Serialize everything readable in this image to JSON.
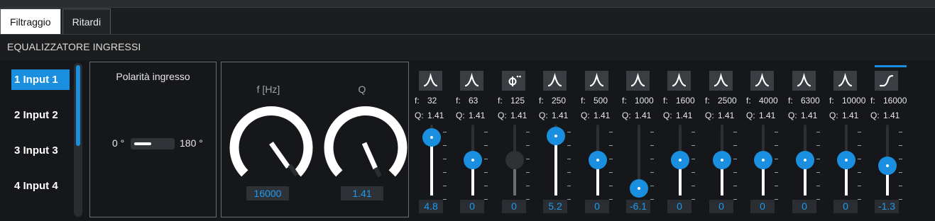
{
  "tabs": [
    {
      "label": "Filtraggio",
      "active": true
    },
    {
      "label": "Ritardi",
      "active": false
    }
  ],
  "section_title": "EQUALIZZATORE INGRESSI",
  "inputs": [
    {
      "label": "1  Input 1",
      "selected": true
    },
    {
      "label": "2  Input 2",
      "selected": false
    },
    {
      "label": "3  Input 3",
      "selected": false
    },
    {
      "label": "4  Input 4",
      "selected": false
    }
  ],
  "polarity": {
    "title": "Polarità ingresso",
    "left_label": "0 °",
    "right_label": "180 °",
    "state": "0 °"
  },
  "knobs": {
    "freq": {
      "label": "f [Hz]",
      "value": "16000"
    },
    "q": {
      "label": "Q",
      "value": "1.41"
    }
  },
  "bands": [
    {
      "type": "peak-icon",
      "f": "32",
      "q": "1.41",
      "gain": "4.8",
      "level": 0.82,
      "enabled": true,
      "selected": false
    },
    {
      "type": "peak-icon",
      "f": "63",
      "q": "1.41",
      "gain": "0",
      "level": 0.5,
      "enabled": true,
      "selected": false
    },
    {
      "type": "phase-icon",
      "f": "125",
      "q": "1.41",
      "gain": "0",
      "level": 0.5,
      "enabled": false,
      "selected": false
    },
    {
      "type": "peak-icon",
      "f": "250",
      "q": "1.41",
      "gain": "5.2",
      "level": 0.84,
      "enabled": true,
      "selected": false
    },
    {
      "type": "peak-icon",
      "f": "500",
      "q": "1.41",
      "gain": "0",
      "level": 0.5,
      "enabled": true,
      "selected": false
    },
    {
      "type": "peak-icon",
      "f": "1000",
      "q": "1.41",
      "gain": "-6.1",
      "level": 0.1,
      "enabled": true,
      "selected": false
    },
    {
      "type": "peak-icon",
      "f": "1600",
      "q": "1.41",
      "gain": "0",
      "level": 0.5,
      "enabled": true,
      "selected": false
    },
    {
      "type": "peak-icon",
      "f": "2500",
      "q": "1.41",
      "gain": "0",
      "level": 0.5,
      "enabled": true,
      "selected": false
    },
    {
      "type": "peak-icon",
      "f": "4000",
      "q": "1.41",
      "gain": "0",
      "level": 0.5,
      "enabled": true,
      "selected": false
    },
    {
      "type": "peak-icon",
      "f": "6300",
      "q": "1.41",
      "gain": "0",
      "level": 0.5,
      "enabled": true,
      "selected": false
    },
    {
      "type": "peak-icon",
      "f": "10000",
      "q": "1.41",
      "gain": "0",
      "level": 0.5,
      "enabled": true,
      "selected": false
    },
    {
      "type": "high-shelf-icon",
      "f": "16000",
      "q": "1.41",
      "gain": "-1.3",
      "level": 0.42,
      "enabled": true,
      "selected": true
    }
  ],
  "labels": {
    "f": "f:",
    "q": "Q:"
  },
  "colors": {
    "accent": "#1a8fe0",
    "value_text": "#1e9bf0",
    "background": "#15171a"
  }
}
